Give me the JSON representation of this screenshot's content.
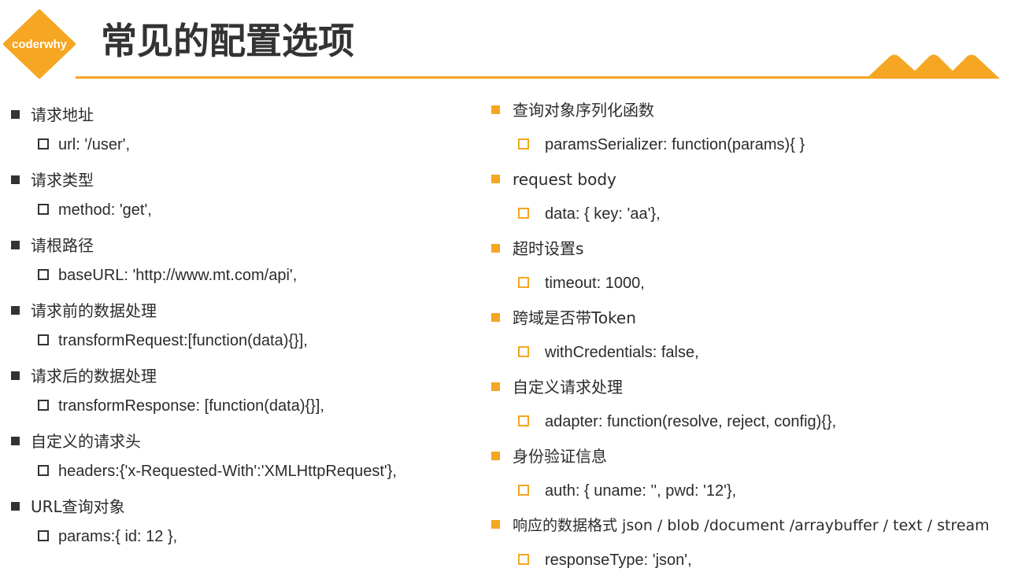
{
  "header": {
    "logo_text": "coderwhy",
    "title": "常见的配置选项"
  },
  "colors": {
    "accent": "#f5a623",
    "text": "#2b2b2b",
    "dark_bullet": "#333333"
  },
  "left_items": [
    {
      "label": "请求地址",
      "value": "url: '/user',"
    },
    {
      "label": "请求类型",
      "value": "method: 'get',"
    },
    {
      "label": "请根路径",
      "value": "baseURL: 'http://www.mt.com/api',"
    },
    {
      "label": "请求前的数据处理",
      "value": "transformRequest:[function(data){}],"
    },
    {
      "label": "请求后的数据处理",
      "value": "transformResponse: [function(data){}],"
    },
    {
      "label": "自定义的请求头",
      "value": "headers:{'x-Requested-With':'XMLHttpRequest'},"
    },
    {
      "label": "URL查询对象",
      "value": "params:{ id: 12 },"
    }
  ],
  "right_items": [
    {
      "label": "查询对象序列化函数",
      "value": "paramsSerializer: function(params){ }"
    },
    {
      "label": "request body",
      "value": "data: { key: 'aa'},"
    },
    {
      "label": "超时设置s",
      "value": "timeout: 1000,"
    },
    {
      "label": "跨域是否带Token",
      "value": "withCredentials: false,"
    },
    {
      "label": "自定义请求处理",
      "value": "adapter: function(resolve, reject, config){},"
    },
    {
      "label": "身份验证信息",
      "value": "auth: { uname: '', pwd: '12'},"
    },
    {
      "label": "响应的数据格式 json / blob /document /arraybuffer / text / stream",
      "value": "responseType: 'json',"
    }
  ]
}
